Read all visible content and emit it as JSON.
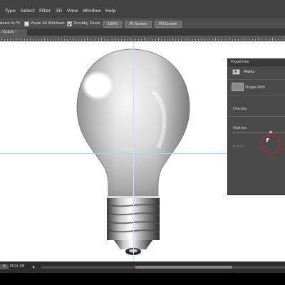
{
  "menu": {
    "items": [
      "Type",
      "Select",
      "Filter",
      "3D",
      "View",
      "Window",
      "Help"
    ]
  },
  "options_bar": {
    "resize_label": "dows to Fit",
    "zoom_all_label": "Zoom All Windows",
    "scrubby_label": "Scrubby Zoom",
    "zoom_value": "100%",
    "fit_screen": "Fit Screen",
    "fill_screen": "Fill Screen",
    "zoom_all_checked": false,
    "scrubby_checked": true
  },
  "document_tab": {
    "label": "(RGB/8) *"
  },
  "properties_panel": {
    "title": "Properties",
    "mode": "Masks",
    "shape_label": "Shape Path",
    "density_label": "Density:",
    "feather_label": "Feather:",
    "refine_label": "Refine:",
    "feather_level": 0.72
  },
  "status": {
    "zoom": "%",
    "doc_info": "M/24.6M"
  },
  "colors": {
    "guide": "#8fe2ee",
    "click_ring": "#c0262c"
  },
  "icons": {
    "mode_icon": "layer-mask-icon",
    "shape_icon": "vector-mask-icon",
    "cursor": "mouse-pointer-icon"
  }
}
